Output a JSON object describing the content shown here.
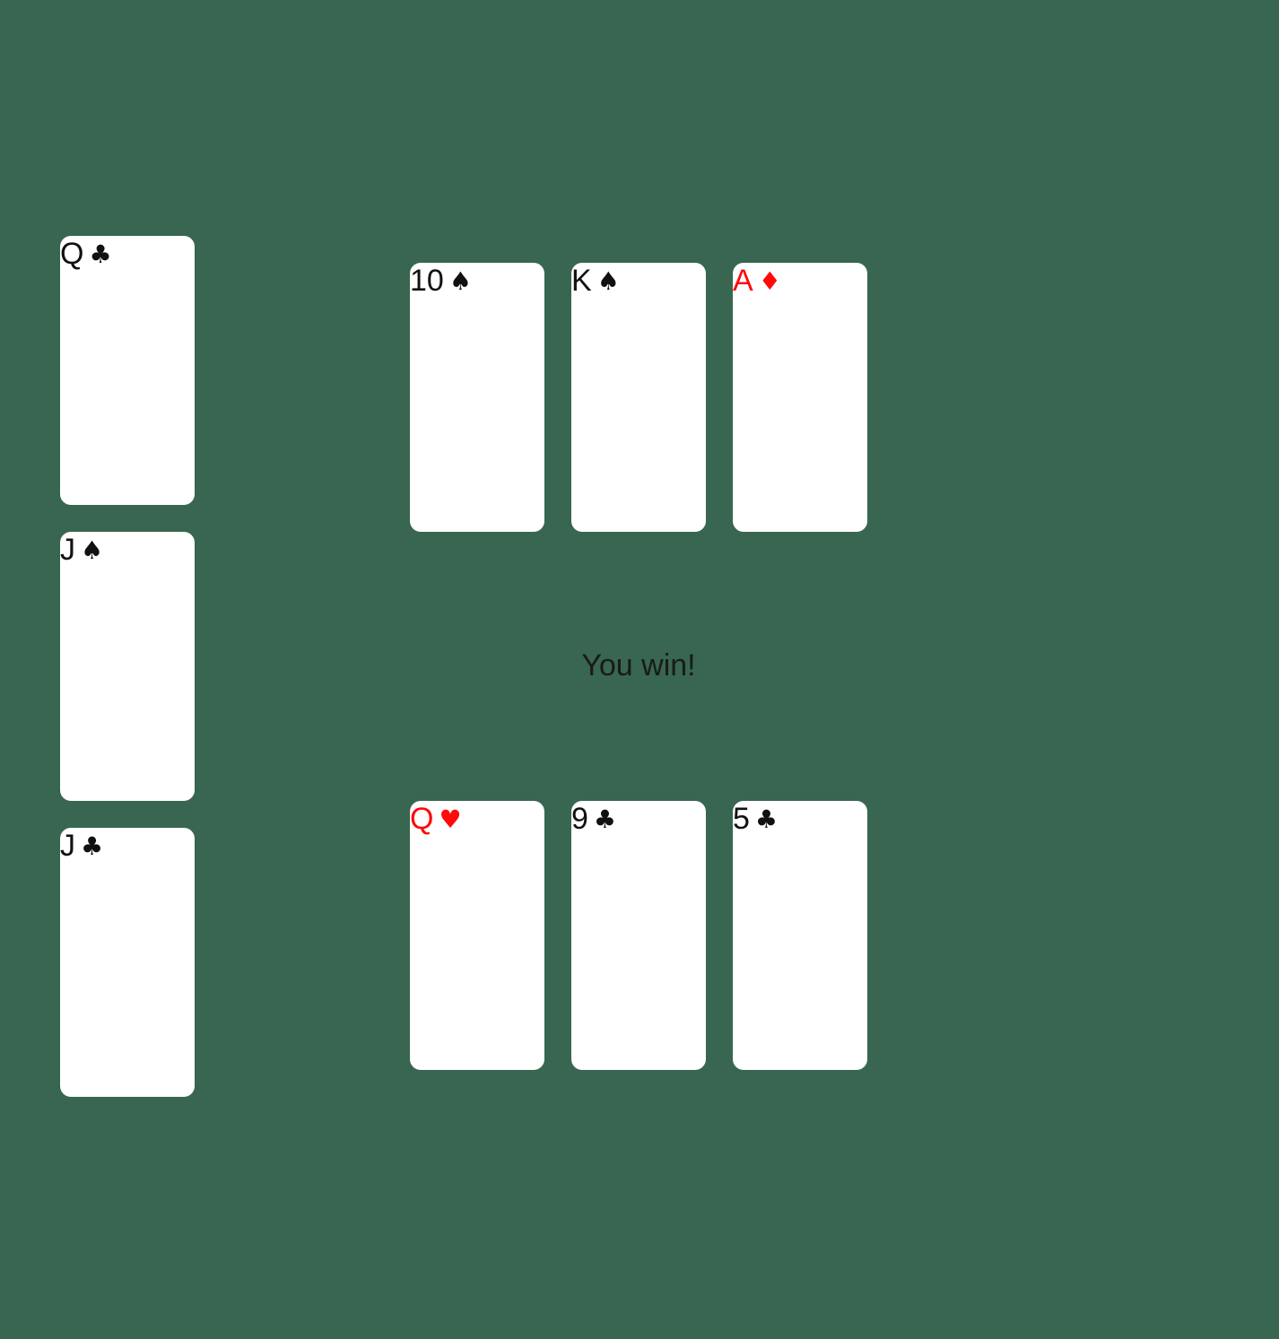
{
  "side_column": [
    {
      "rank": "Q",
      "suit": "♣",
      "color": "black"
    },
    {
      "rank": "J",
      "suit": "♠",
      "color": "black"
    },
    {
      "rank": "J",
      "suit": "♣",
      "color": "black"
    }
  ],
  "top_row": [
    {
      "rank": "10",
      "suit": "♠",
      "color": "black"
    },
    {
      "rank": "K",
      "suit": "♠",
      "color": "black"
    },
    {
      "rank": "A",
      "suit": "♦",
      "color": "red"
    }
  ],
  "bottom_row": [
    {
      "rank": "Q",
      "suit": "♥",
      "color": "red"
    },
    {
      "rank": "9",
      "suit": "♣",
      "color": "black"
    },
    {
      "rank": "5",
      "suit": "♣",
      "color": "black"
    }
  ],
  "status_text": "You win!",
  "colors": {
    "table": "#386650",
    "card": "#ffffff",
    "red_suit": "#ff0a0a",
    "black_suit": "#111111"
  }
}
